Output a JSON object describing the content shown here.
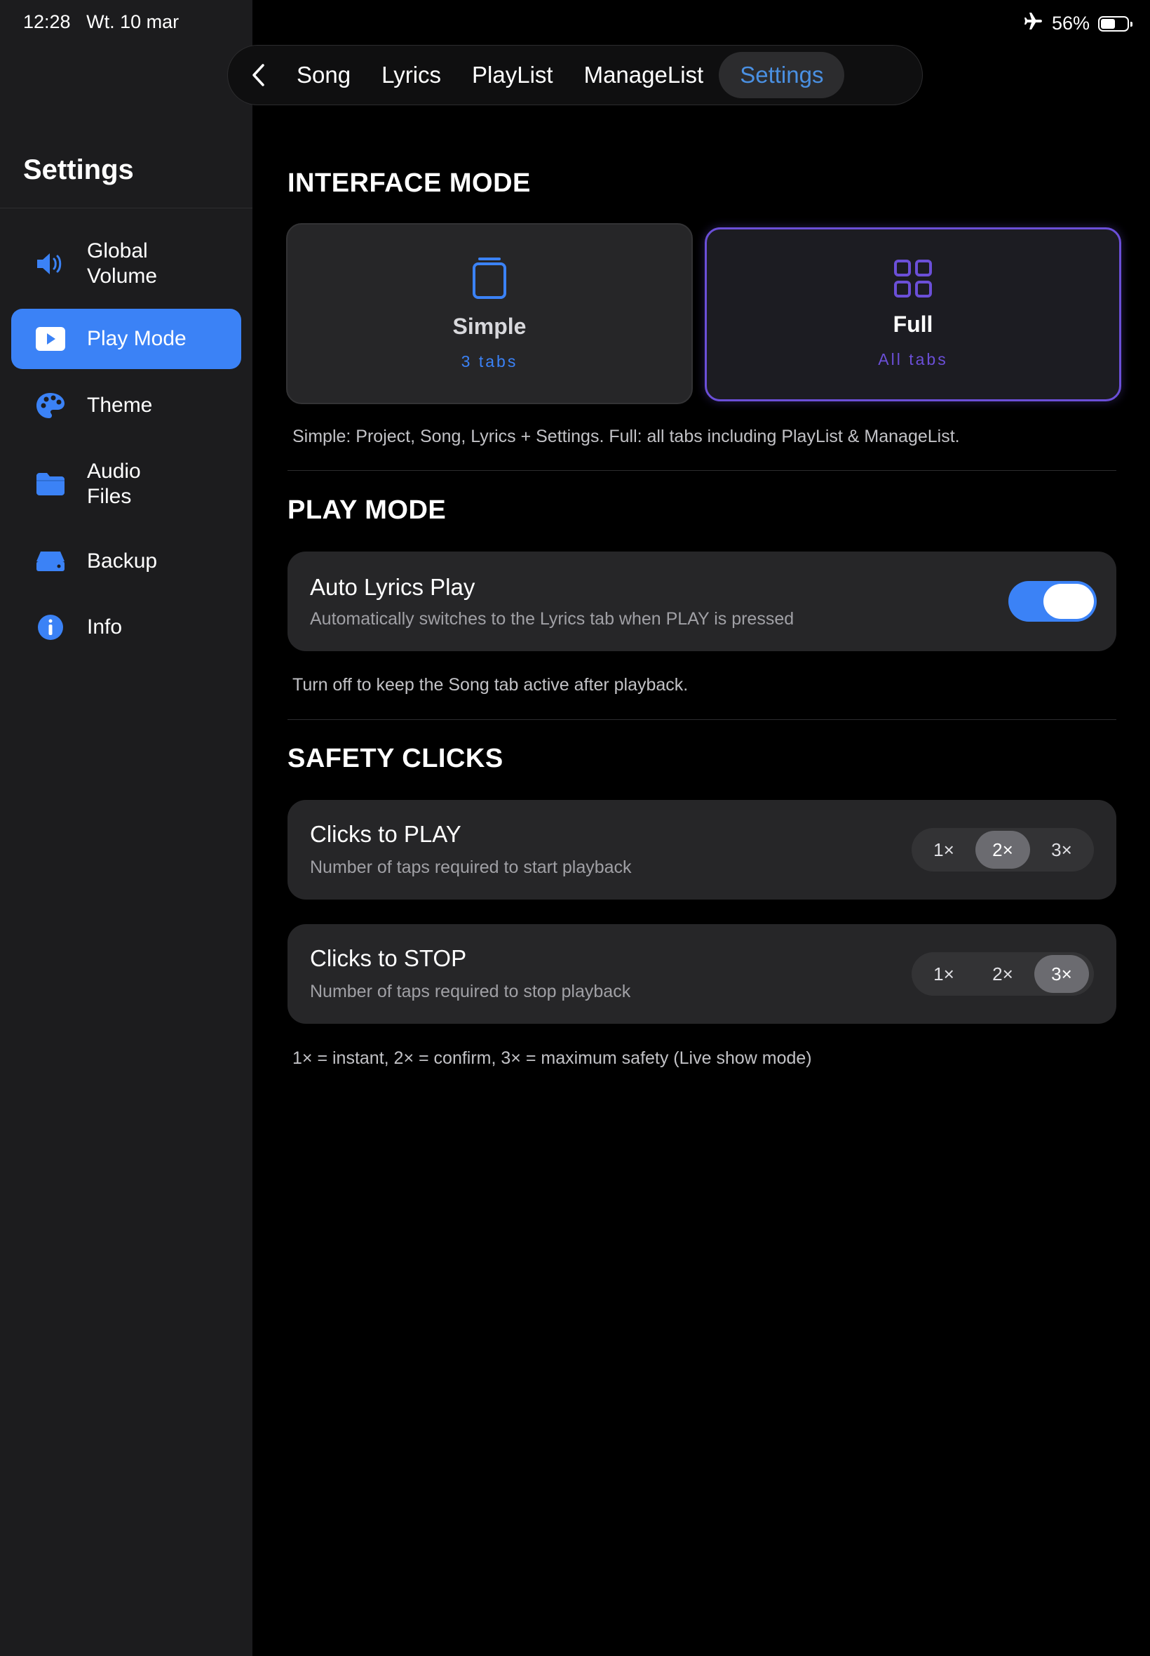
{
  "status": {
    "time": "12:28",
    "date": "Wt. 10 mar",
    "battery": "56%",
    "battery_level": 0.56
  },
  "tabs": [
    {
      "label": "Song"
    },
    {
      "label": "Lyrics"
    },
    {
      "label": "PlayList"
    },
    {
      "label": "ManageList"
    },
    {
      "label": "Settings",
      "active": true
    }
  ],
  "sidebar": {
    "title": "Settings",
    "items": [
      {
        "label": "Global\nVolume",
        "icon": "speaker-icon"
      },
      {
        "label": "Play Mode",
        "icon": "play-icon",
        "active": true
      },
      {
        "label": "Theme",
        "icon": "palette-icon"
      },
      {
        "label": "Audio\nFiles",
        "icon": "folder-icon"
      },
      {
        "label": "Backup",
        "icon": "drive-icon"
      },
      {
        "label": "Info",
        "icon": "info-icon"
      }
    ]
  },
  "interface_mode": {
    "title": "INTERFACE MODE",
    "simple": {
      "title": "Simple",
      "sub": "3 tabs"
    },
    "full": {
      "title": "Full",
      "sub": "All tabs",
      "selected": true
    },
    "note": "Simple: Project, Song, Lyrics + Settings. Full: all tabs including PlayList & ManageList."
  },
  "play_mode": {
    "title": "PLAY MODE",
    "auto_lyrics": {
      "title": "Auto Lyrics Play",
      "sub": "Automatically switches to the Lyrics tab when PLAY is pressed",
      "enabled": true
    },
    "note": "Turn off to keep the Song tab active after playback."
  },
  "safety_clicks": {
    "title": "SAFETY CLICKS",
    "play": {
      "title": "Clicks to PLAY",
      "sub": "Number of taps required to start playback",
      "options": [
        "1×",
        "2×",
        "3×"
      ],
      "selected": "2×"
    },
    "stop": {
      "title": "Clicks to STOP",
      "sub": "Number of taps required to stop playback",
      "options": [
        "1×",
        "2×",
        "3×"
      ],
      "selected": "3×"
    },
    "note": "1× = instant, 2× = confirm, 3× = maximum safety (Live show mode)"
  },
  "colors": {
    "accent": "#3b82f6",
    "tab_active": "#4a90e2",
    "full_mode": "#6b4fd8",
    "sidebar_bg": "#1c1c1e"
  }
}
